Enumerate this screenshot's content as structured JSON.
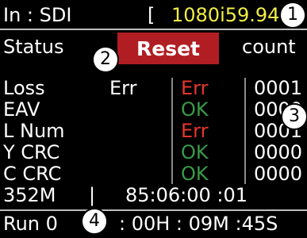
{
  "input": {
    "label": "In : SDI",
    "bracket": "[",
    "format": "1080i59.94"
  },
  "status": {
    "label": "Status",
    "reset_label": "Reset",
    "count_label": "count"
  },
  "rows": [
    {
      "name": "Loss",
      "col1": "Err",
      "col2": "Err",
      "count": "0001"
    },
    {
      "name": "EAV",
      "col1": "",
      "col2": "OK",
      "count": "0000"
    },
    {
      "name": "L Num",
      "col1": "",
      "col2": "Err",
      "count": "0001"
    },
    {
      "name": "Y CRC",
      "col1": "",
      "col2": "OK",
      "count": "0000"
    },
    {
      "name": "C CRC",
      "col1": "",
      "col2": "OK",
      "count": "0000"
    }
  ],
  "footer": {
    "rate": "352M",
    "bar": "|",
    "timecode": "85:06:00 :01"
  },
  "run": {
    "label": "Run 0",
    "time": ": 00H : 09M :45S"
  },
  "callouts": [
    "1",
    "2",
    "3",
    "4"
  ],
  "colors": {
    "ok": "#3a9a48",
    "err": "#e8352c",
    "format": "#f2ee44",
    "reset": "#b01e23"
  }
}
